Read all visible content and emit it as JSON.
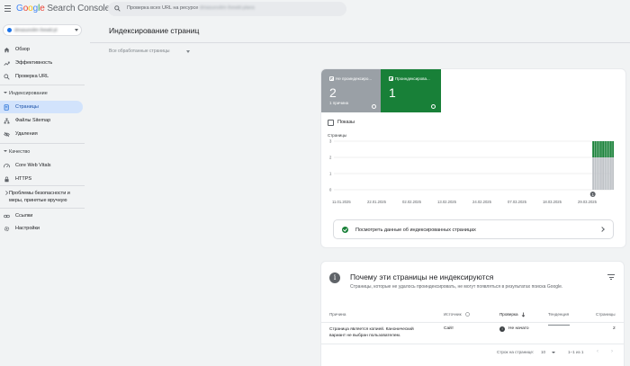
{
  "app": {
    "logo": {
      "g1": "G",
      "g2": "o",
      "g3": "o",
      "g4": "g",
      "rest1": "l",
      "rest2": "e",
      "product": " Search Console"
    },
    "search": {
      "prefix": "Проверка всех URL на ресурсе",
      "property_blurred": "dmasunolim ihewkl.plans"
    }
  },
  "sidebar": {
    "property_name": "dmasunolim ihewkl.pl",
    "items": [
      {
        "label": "Обзор",
        "icon": "home-icon"
      },
      {
        "label": "Эффективность",
        "icon": "trending-up-icon"
      },
      {
        "label": "Проверка URL",
        "icon": "search-icon"
      }
    ],
    "sections": [
      {
        "label": "Индексирование",
        "items": [
          {
            "label": "Страницы",
            "icon": "pages-icon",
            "active": true
          },
          {
            "label": "Файлы Sitemap",
            "icon": "sitemap-icon"
          },
          {
            "label": "Удаления",
            "icon": "eye-off-icon"
          }
        ]
      },
      {
        "label": "Качество",
        "items": [
          {
            "label": "Core Web Vitals",
            "icon": "speed-icon"
          },
          {
            "label": "HTTPS",
            "icon": "lock-icon"
          }
        ]
      }
    ],
    "security_item": "Проблемы безопасности и меры, принятые вручную",
    "bottom_items": [
      {
        "label": "Ссылки",
        "icon": "links-icon"
      },
      {
        "label": "Настройки",
        "icon": "gear-icon"
      }
    ]
  },
  "header": {
    "title": "Индексирование страниц",
    "filter_label": "Все обработанные страницы"
  },
  "summary": {
    "not_indexed": {
      "label": "Не проиндексиро...",
      "value": "2",
      "sub": "1 причина",
      "color": "#9aa0a6"
    },
    "indexed": {
      "label": "Проиндексирова...",
      "value": "1",
      "color": "#188038"
    },
    "shows_label": "Показы"
  },
  "chart_data": {
    "type": "bar",
    "ylabel": "Страницы",
    "yticks": [
      "0",
      "1",
      "2",
      "3"
    ],
    "ylim": [
      0,
      3
    ],
    "xticks": [
      "11.01.2025",
      "22.01.2025",
      "02.02.2025",
      "13.02.2025",
      "24.02.2025",
      "07.03.2025",
      "18.03.2025",
      "29.03.2025"
    ],
    "stacked": true,
    "series": [
      {
        "name": "Не проиндексировано",
        "color": "#bdc1c6",
        "values": [
          2,
          2,
          2,
          2,
          2,
          2,
          2,
          2,
          2,
          2,
          2
        ]
      },
      {
        "name": "Проиндексировано",
        "color": "#188038",
        "values": [
          1,
          1,
          1,
          1,
          1,
          1,
          1,
          1,
          1,
          1,
          1
        ]
      }
    ],
    "bars_start_date": "01.04.2025",
    "annotation": "1",
    "grid": true
  },
  "link_row": {
    "label": "Посмотреть данные об индексированных страницах"
  },
  "reasons": {
    "title": "Почему эти страницы не индексируются",
    "subtitle": "Страницы, которые не удалось проиндексировать, не могут появляться в результатах поиска Google.",
    "columns": {
      "reason": "Причина",
      "source": "Источник",
      "check": "Проверка",
      "trend": "Тенденция",
      "pages": "Страницы"
    },
    "rows": [
      {
        "reason": "Страница является копией. Канонический вариант не выбран пользователем.",
        "source": "Сайт",
        "check": "Не начато",
        "pages": "2"
      }
    ],
    "pager": {
      "rows_label": "Строк на странице:",
      "rows_value": "10",
      "range": "1–1 из 1"
    }
  }
}
